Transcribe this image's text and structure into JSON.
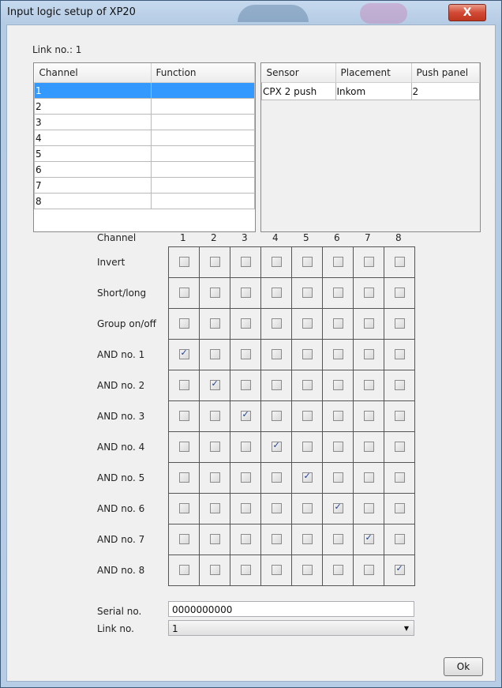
{
  "window": {
    "title": "Input logic setup of XP20",
    "close_label": "X"
  },
  "link_label": "Link no.: 1",
  "channel_table": {
    "headers": [
      "Channel",
      "Function"
    ],
    "rows": [
      {
        "channel": "1",
        "function": ""
      },
      {
        "channel": "2",
        "function": ""
      },
      {
        "channel": "3",
        "function": ""
      },
      {
        "channel": "4",
        "function": ""
      },
      {
        "channel": "5",
        "function": ""
      },
      {
        "channel": "6",
        "function": ""
      },
      {
        "channel": "7",
        "function": ""
      },
      {
        "channel": "8",
        "function": ""
      }
    ],
    "selected_row": 0
  },
  "sensor_table": {
    "headers": [
      "Sensor",
      "Placement",
      "Push panel"
    ],
    "rows": [
      {
        "sensor": "CPX 2 push",
        "placement": "Inkom",
        "push_panel": "2"
      }
    ]
  },
  "matrix": {
    "channel_label": "Channel",
    "columns": [
      "1",
      "2",
      "3",
      "4",
      "5",
      "6",
      "7",
      "8"
    ],
    "rows": [
      {
        "label": "Invert",
        "values": [
          false,
          false,
          false,
          false,
          false,
          false,
          false,
          false
        ]
      },
      {
        "label": "Short/long",
        "values": [
          false,
          false,
          false,
          false,
          false,
          false,
          false,
          false
        ]
      },
      {
        "label": "Group on/off",
        "values": [
          false,
          false,
          false,
          false,
          false,
          false,
          false,
          false
        ]
      },
      {
        "label": "AND no. 1",
        "values": [
          true,
          false,
          false,
          false,
          false,
          false,
          false,
          false
        ]
      },
      {
        "label": "AND no. 2",
        "values": [
          false,
          true,
          false,
          false,
          false,
          false,
          false,
          false
        ]
      },
      {
        "label": "AND no. 3",
        "values": [
          false,
          false,
          true,
          false,
          false,
          false,
          false,
          false
        ]
      },
      {
        "label": "AND no. 4",
        "values": [
          false,
          false,
          false,
          true,
          false,
          false,
          false,
          false
        ]
      },
      {
        "label": "AND no. 5",
        "values": [
          false,
          false,
          false,
          false,
          true,
          false,
          false,
          false
        ]
      },
      {
        "label": "AND no. 6",
        "values": [
          false,
          false,
          false,
          false,
          false,
          true,
          false,
          false
        ]
      },
      {
        "label": "AND no. 7",
        "values": [
          false,
          false,
          false,
          false,
          false,
          false,
          true,
          false
        ]
      },
      {
        "label": "AND no. 8",
        "values": [
          false,
          false,
          false,
          false,
          false,
          false,
          false,
          true
        ]
      }
    ]
  },
  "serial": {
    "label": "Serial no.",
    "value": "0000000000"
  },
  "link_select": {
    "label": "Link no.",
    "value": "1"
  },
  "ok_label": "Ok",
  "colors": {
    "selection": "#3399ff",
    "check": "#1c3d8e"
  }
}
